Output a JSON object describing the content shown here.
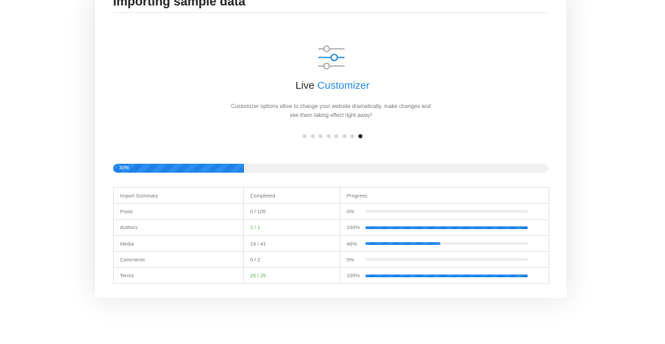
{
  "page": {
    "title": "Importing sample data"
  },
  "slide": {
    "heading_plain": "Live",
    "heading_accent": "Customizer",
    "description": "Customizer options allow to change your website dramatically, make changes and see them taking effect right away!",
    "icon": "sliders-icon",
    "total_dots": 8,
    "active_dot": 8
  },
  "overall_progress": {
    "label": "30%",
    "value": 0.3
  },
  "colors": {
    "accent": "#1e88e5",
    "success": "#4caf50"
  },
  "table": {
    "headers": [
      "Import Summary",
      "Completed",
      "Progress"
    ],
    "rows": [
      {
        "name": "Posts",
        "completed": "0 / 105",
        "progress_label": "0%",
        "progress": 0,
        "done": false
      },
      {
        "name": "Authors",
        "completed": "1 / 1",
        "progress_label": "100%",
        "progress": 1,
        "done": true
      },
      {
        "name": "Media",
        "completed": "19 / 41",
        "progress_label": "46%",
        "progress": 0.46,
        "done": false
      },
      {
        "name": "Comments",
        "completed": "0 / 2",
        "progress_label": "0%",
        "progress": 0,
        "done": false
      },
      {
        "name": "Terms",
        "completed": "25 / 25",
        "progress_label": "100%",
        "progress": 1,
        "done": true
      }
    ],
    "check_glyph": "✓"
  }
}
